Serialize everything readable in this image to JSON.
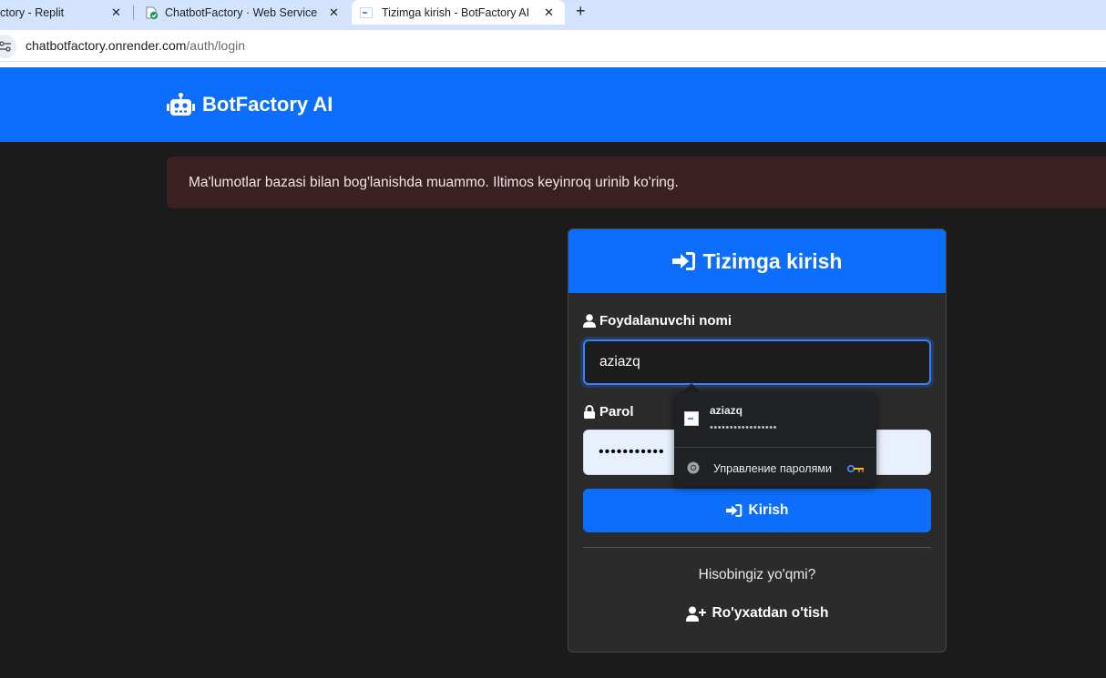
{
  "browser": {
    "tabs": [
      {
        "title": "ctory - Replit"
      },
      {
        "title": "ChatbotFactory · Web Service ·"
      },
      {
        "title": "Tizimga kirish - BotFactory AI"
      }
    ],
    "new_tab_symbol": "+",
    "close_symbol": "✕",
    "url_host": "chatbotfactory.onrender.com",
    "url_path": "/auth/login"
  },
  "navbar": {
    "brand": "BotFactory AI",
    "brand_icon": "robot-icon"
  },
  "alert": {
    "message": "Ma'lumotlar bazasi bilan bog'lanishda muammo. Iltimos keyinroq urinib ko'ring."
  },
  "login_card": {
    "title": "Tizimga kirish",
    "username_label": "Foydalanuvchi nomi",
    "username_value": "aziazq",
    "password_label": "Parol",
    "password_value": "•••••••••••",
    "submit_label": "Kirish",
    "no_account_text": "Hisobingiz yo'qmi?",
    "register_label": "Ro'yxatdan o'tish"
  },
  "password_popup": {
    "username": "aziazq",
    "password_mask": "•••••••••••••••••",
    "manage_label": "Управление паролями"
  },
  "colors": {
    "primary": "#0d6efd",
    "page_bg": "#1b1b1b",
    "card_bg": "#2b2b2b",
    "alert_bg": "#3a2022"
  }
}
